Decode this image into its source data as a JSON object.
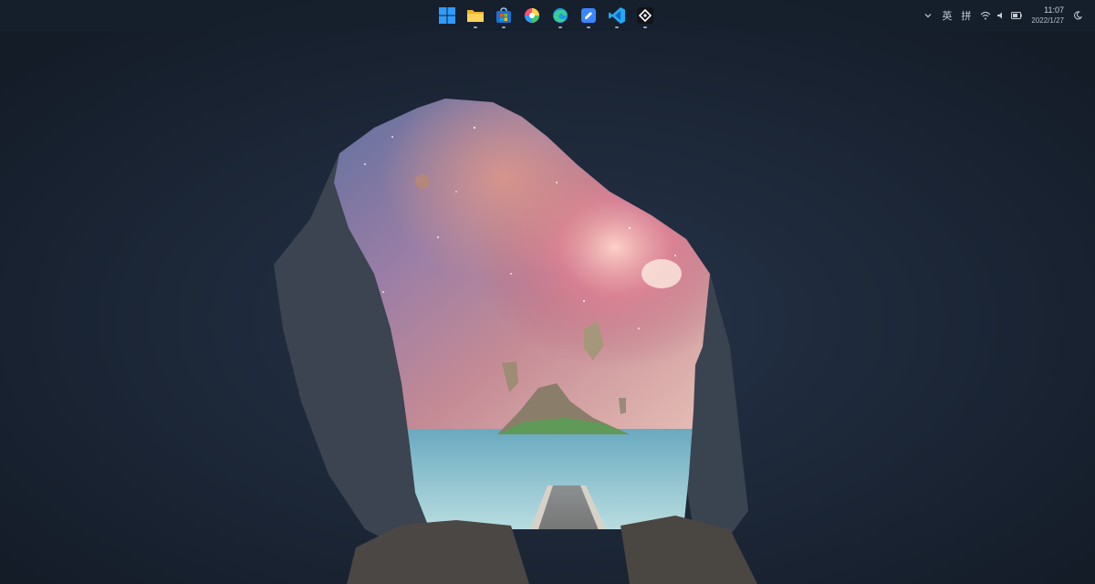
{
  "taskbar": {
    "pinned_apps": [
      {
        "icon": "windows-start-icon",
        "running": false
      },
      {
        "icon": "file-explorer-icon",
        "running": true
      },
      {
        "icon": "microsoft-store-icon",
        "running": true
      },
      {
        "icon": "color-wheel-app-icon",
        "running": false
      },
      {
        "icon": "edge-browser-icon",
        "running": true
      },
      {
        "icon": "notes-pen-app-icon",
        "running": true
      },
      {
        "icon": "vscode-icon",
        "running": true
      },
      {
        "icon": "git-app-icon",
        "running": true
      }
    ]
  },
  "tray": {
    "chevron_icon": "chevron-up-icon",
    "ime_lang": "英",
    "ime_mode": "拼",
    "wifi_icon": "wifi-icon",
    "volume_icon": "volume-icon",
    "battery_icon": "battery-icon",
    "time": "11:07",
    "date": "2022/1/27",
    "notification_icon": "moon-focus-icon"
  },
  "desktop": {
    "wallpaper": "cave-opening-with-galaxy-sky-and-island",
    "colors": {
      "cave": "#1a2332",
      "sky_pink": "#d27f88",
      "sea": "#7fb9c8"
    }
  }
}
